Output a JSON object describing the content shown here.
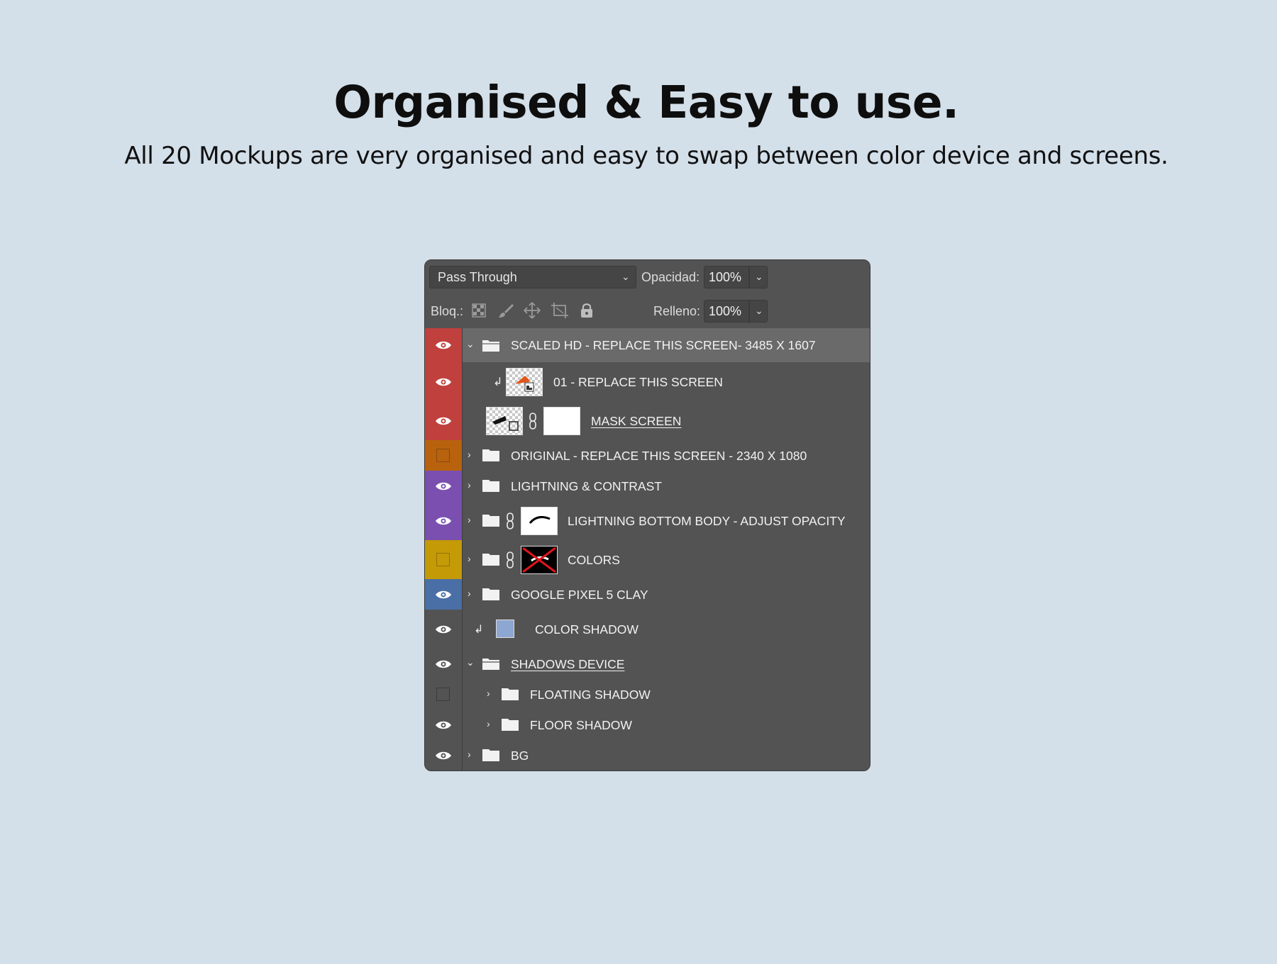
{
  "headline": "Organised & Easy to use.",
  "subline": "All 20 Mockups are very organised and easy to swap between color device and screens.",
  "panel": {
    "blend_mode": "Pass Through",
    "opacity_label": "Opacidad:",
    "opacity_value": "100%",
    "lock_label": "Bloq.:",
    "fill_label": "Relleno:",
    "fill_value": "100%"
  },
  "layers": [
    {
      "name": "SCALED HD - REPLACE THIS SCREEN- 3485 X 1607",
      "color": "#c0403d",
      "visible": true,
      "type": "group",
      "expanded": true,
      "selected": true
    },
    {
      "name": "01 - REPLACE THIS SCREEN",
      "color": "#c0403d",
      "visible": true,
      "type": "smart-object",
      "clipped": true
    },
    {
      "name": "MASK SCREEN",
      "color": "#c0403d",
      "visible": true,
      "type": "masked-layer"
    },
    {
      "name": "ORIGINAL - REPLACE THIS SCREEN - 2340 X 1080",
      "color": "#b8620e",
      "visible": false,
      "type": "group"
    },
    {
      "name": "LIGHTNING & CONTRAST",
      "color": "#7a4fb0",
      "visible": true,
      "type": "group"
    },
    {
      "name": "LIGHTNING BOTTOM BODY - ADJUST OPACITY",
      "color": "#7a4fb0",
      "visible": true,
      "type": "masked-group"
    },
    {
      "name": "COLORS",
      "color": "#c49a06",
      "visible": false,
      "type": "masked-group"
    },
    {
      "name": "GOOGLE PIXEL 5 CLAY",
      "color": "#4a6fa6",
      "visible": true,
      "type": "group"
    },
    {
      "name": "COLOR SHADOW",
      "color": "#535353",
      "visible": true,
      "type": "fill",
      "clipped": true,
      "fill_color": "#8ea6d2"
    },
    {
      "name": "SHADOWS DEVICE",
      "color": "#535353",
      "visible": true,
      "type": "group",
      "expanded": true
    },
    {
      "name": "FLOATING SHADOW",
      "color": "#535353",
      "visible": false,
      "type": "group"
    },
    {
      "name": "FLOOR SHADOW",
      "color": "#535353",
      "visible": true,
      "type": "group"
    },
    {
      "name": "BG",
      "color": "#535353",
      "visible": true,
      "type": "group"
    }
  ]
}
